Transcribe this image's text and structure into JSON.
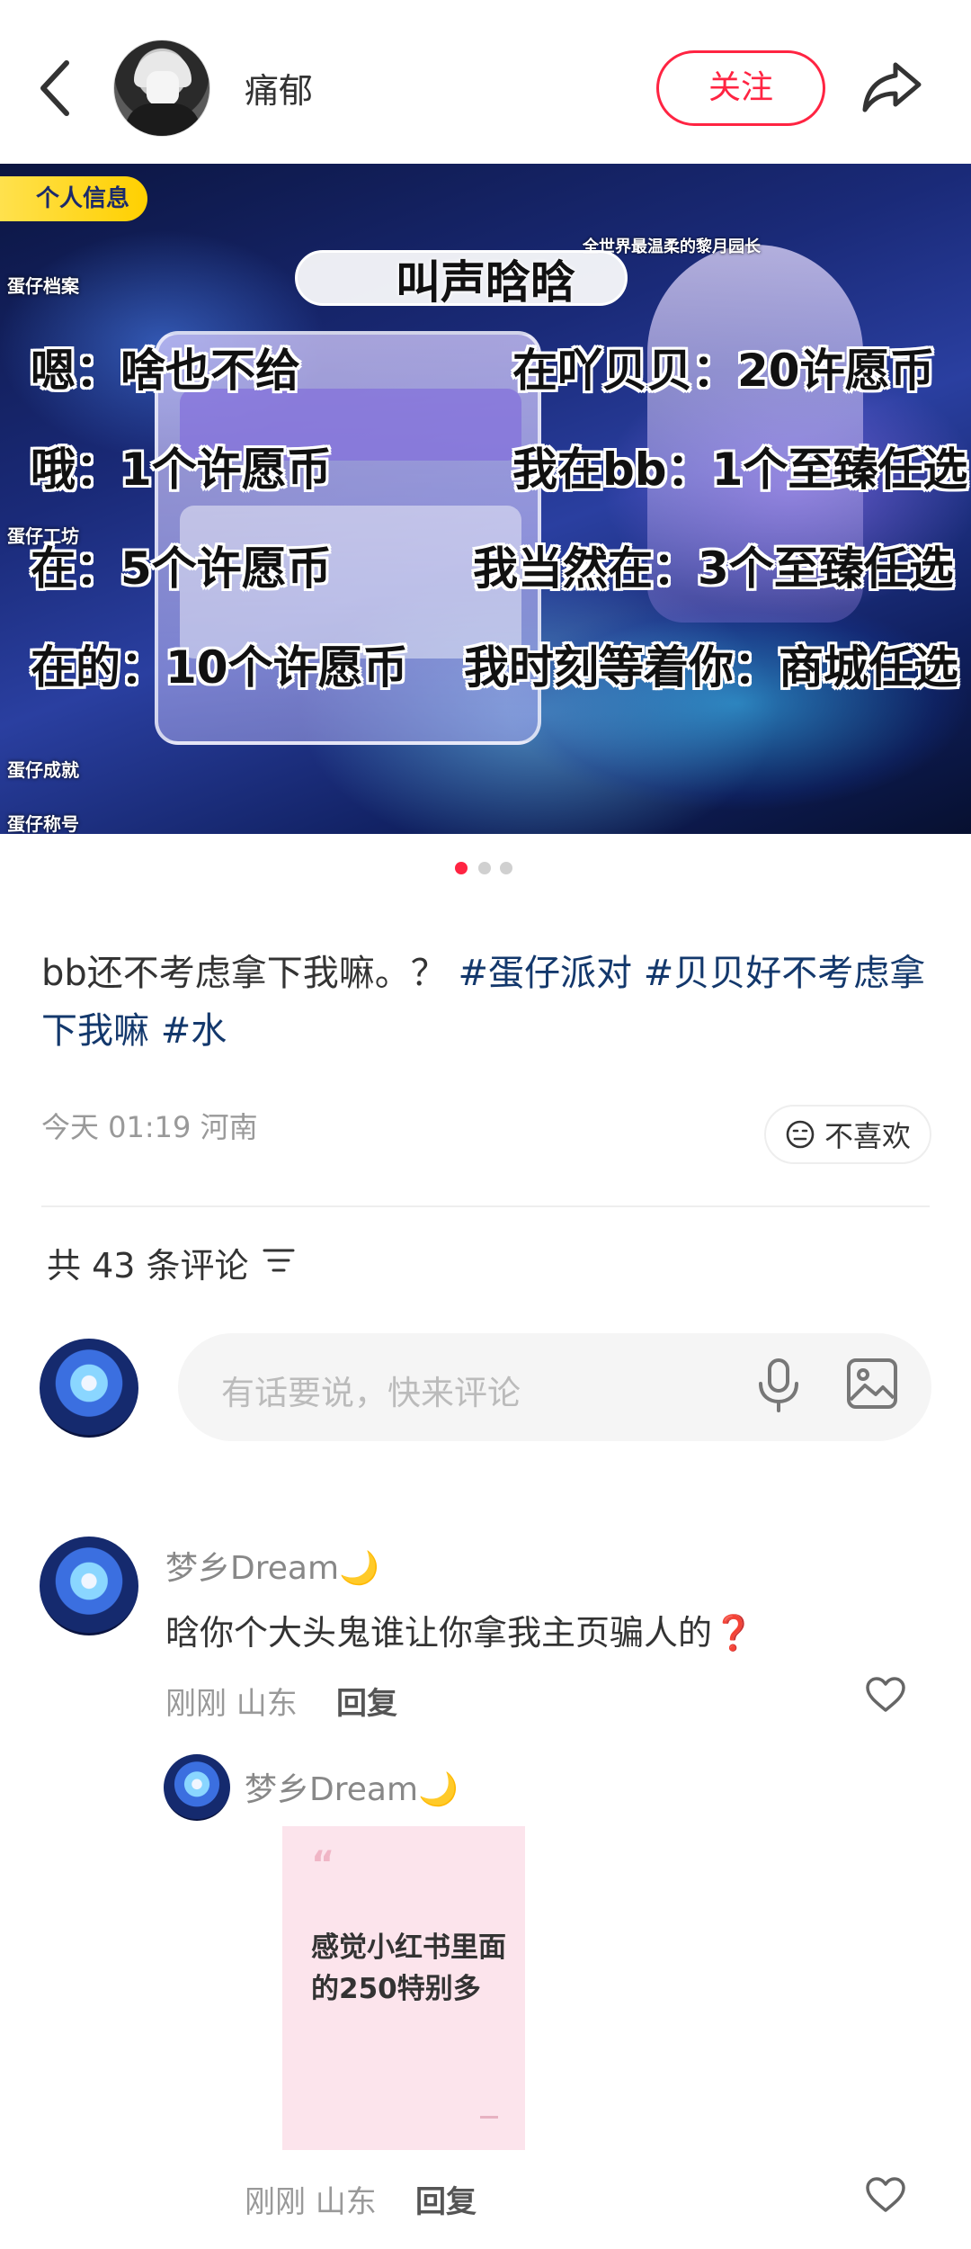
{
  "header": {
    "username": "痛郁",
    "follow_label": "关注"
  },
  "hero": {
    "banner_label": "个人信息",
    "side_tags": [
      "蛋仔档案",
      "蛋仔工坊",
      "蛋仔成就",
      "蛋仔称号"
    ],
    "top_badge": "全世界最温柔的黎月园长",
    "overlay_title": "叫声晗晗",
    "overlay_lines": [
      {
        "left": "嗯：啥也不给",
        "right": "在吖贝贝：20许愿币"
      },
      {
        "left": "哦：1个许愿币",
        "right": "我在bb：1个至臻任选"
      },
      {
        "left": "在：5个许愿币",
        "right": "我当然在：3个至臻任选"
      },
      {
        "left": "在的：10个许愿币",
        "right": "我时刻等着你：商城任选"
      }
    ],
    "page_count": 3,
    "active_page": 1
  },
  "post": {
    "text": "bb还不考虑拿下我嘛。？",
    "tags": [
      "#蛋仔派对",
      "#贝贝好不考虑拿下我嘛",
      "#水"
    ],
    "meta": "今天 01:19 河南",
    "dislike_label": "不喜欢"
  },
  "comments": {
    "count_label": "共 43 条评论",
    "input_placeholder": "有话要说，快来评论",
    "items": [
      {
        "author": "梦乡Dream🌙",
        "body": "晗你个大头鬼谁让你拿我主页骗人的❓",
        "meta": "刚刚 山东",
        "reply_label": "回复"
      },
      {
        "author": "梦乡Dream🌙",
        "quote_mark": "“",
        "quote_text": "感觉小红书里面的250特别多",
        "meta": "刚刚 山东",
        "reply_label": "回复"
      }
    ]
  },
  "colors": {
    "accent": "#ff2442",
    "tag": "#13386c",
    "quote_bg": "#fce4ec"
  },
  "icons": [
    "back-icon",
    "share-icon",
    "sort-icon",
    "mic-icon",
    "image-icon",
    "heart-icon",
    "neutral-face-icon"
  ]
}
